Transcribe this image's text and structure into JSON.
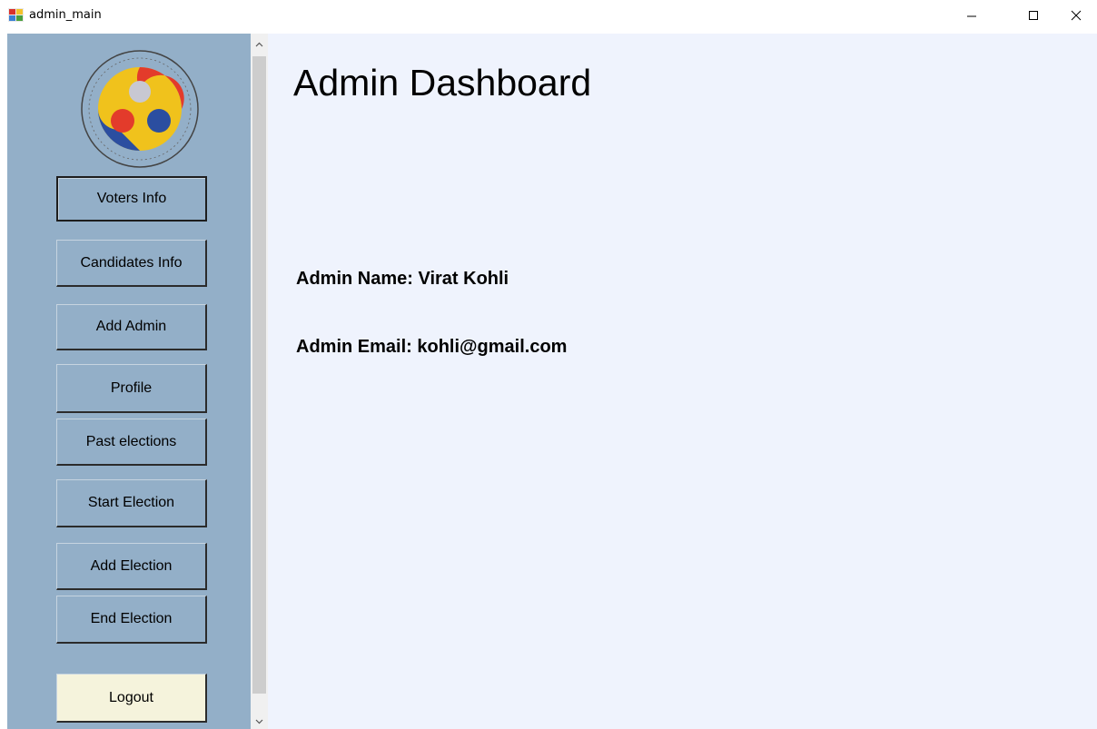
{
  "window": {
    "title": "admin_main",
    "controls": {
      "minimize": "minimize",
      "maximize": "maximize",
      "close": "close"
    }
  },
  "sidebar": {
    "logo": "institute-logo",
    "buttons": [
      {
        "label": "Voters Info"
      },
      {
        "label": "Candidates Info"
      },
      {
        "label": "Add Admin"
      },
      {
        "label": "Profile"
      },
      {
        "label": "Past elections"
      },
      {
        "label": "Start Election"
      },
      {
        "label": "Add Election"
      },
      {
        "label": "End Election"
      },
      {
        "label": "Logout"
      }
    ]
  },
  "main": {
    "title": "Admin Dashboard",
    "admin_name": "Admin Name: Virat Kohli",
    "admin_email": "Admin Email: kohli@gmail.com"
  },
  "colors": {
    "sidebar_bg": "#93afc8",
    "main_bg": "#eff3fd",
    "logout_bg": "#f5f3dc"
  }
}
